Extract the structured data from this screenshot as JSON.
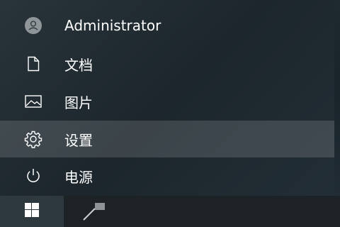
{
  "start_menu": {
    "items": [
      {
        "label": "Administrator",
        "icon": "user-avatar-icon"
      },
      {
        "label": "文档",
        "icon": "document-icon"
      },
      {
        "label": "图片",
        "icon": "picture-icon"
      },
      {
        "label": "设置",
        "icon": "gear-icon",
        "highlighted": true
      },
      {
        "label": "电源",
        "icon": "power-icon"
      }
    ]
  },
  "taskbar": {
    "start_icon": "windows-logo-icon",
    "pinned_icon": "app-icon"
  },
  "colors": {
    "text": "#ffffff",
    "menu_bg": "#1f2a30",
    "highlight": "#4a5358",
    "taskbar": "#1c2226",
    "start_button": "#2e393f"
  }
}
